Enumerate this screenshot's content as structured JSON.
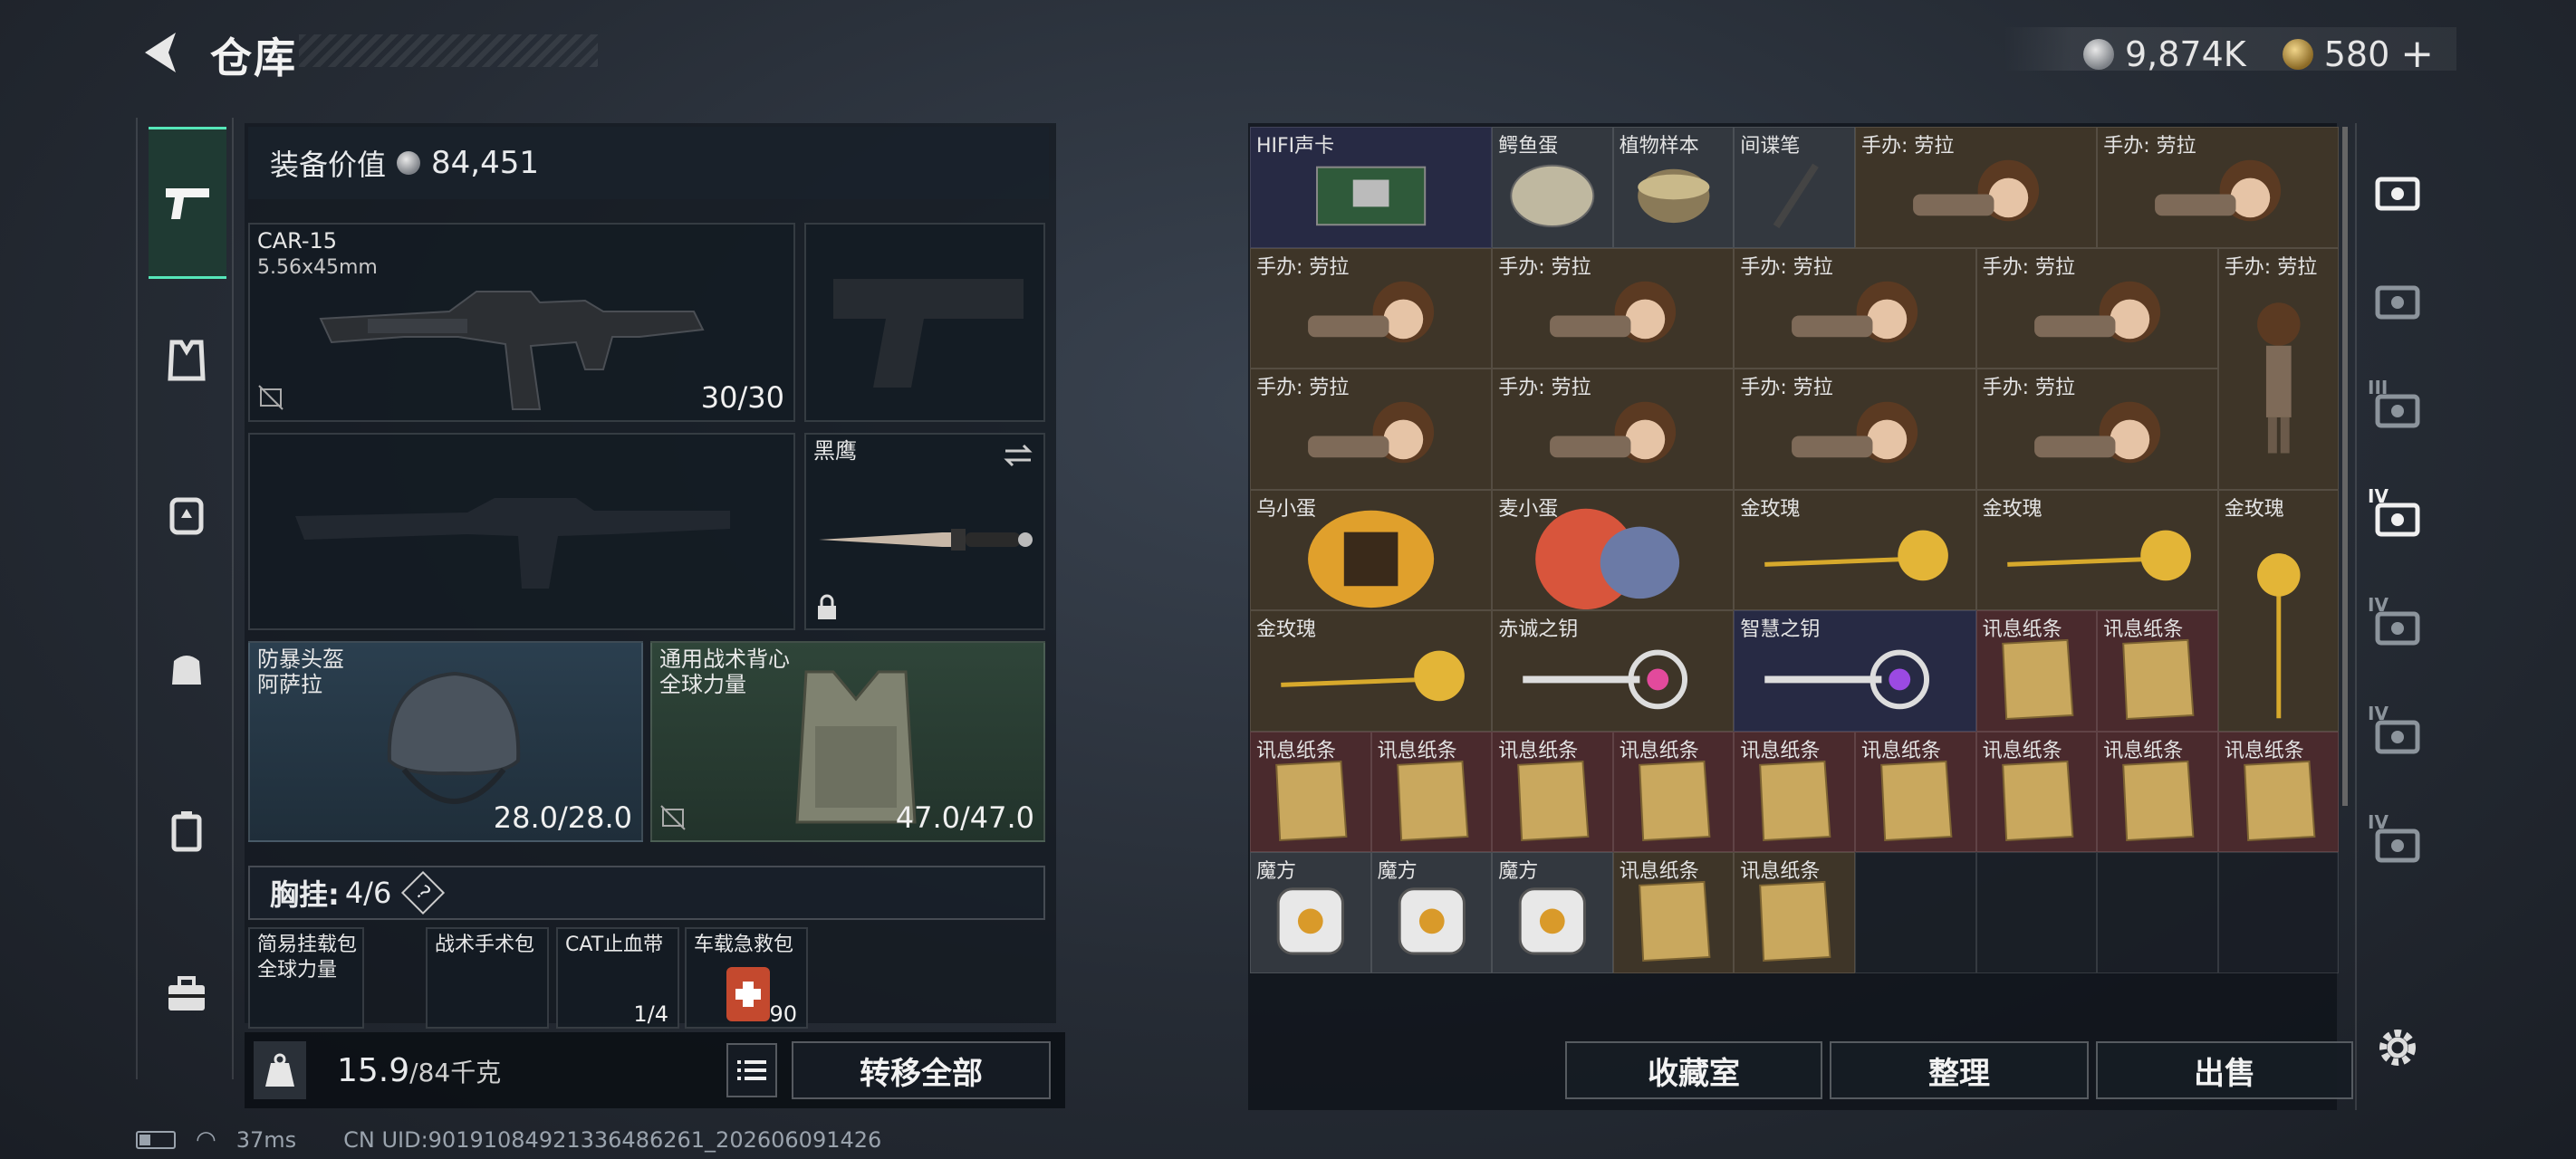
{
  "header": {
    "title": "仓库",
    "currency1": "9,874K",
    "currency2": "580",
    "plus": "+"
  },
  "equipment": {
    "value_label": "装备价值",
    "value": "84,451",
    "primary": {
      "name": "CAR-15",
      "ammo_type": "5.56x45mm",
      "ammo": "30/30"
    },
    "melee": {
      "name": "黑鹰"
    },
    "helmet": {
      "name": "防暴头盔",
      "sub": "阿萨拉",
      "durability": "28.0/28.0"
    },
    "vest": {
      "name": "通用战术背心",
      "sub": "全球力量",
      "durability": "47.0/47.0"
    },
    "rig": {
      "label": "胸挂:",
      "count": "4/6",
      "help": "?"
    },
    "rig_items": [
      {
        "name": "简易挂载包",
        "sub": "全球力量"
      },
      {
        "name": "战术手术包",
        "sub": ""
      },
      {
        "name": "CAT止血带",
        "sub": "",
        "val": "1/4"
      },
      {
        "name": "车载急救包",
        "sub": "",
        "val": "90"
      }
    ],
    "weight": "15.9",
    "weight_max": "/84千克",
    "transfer_all": "转移全部"
  },
  "stash": {
    "items": [
      {
        "label": "HIFI声卡",
        "q": "navy",
        "icon": "card"
      },
      {
        "label": "鳄鱼蛋",
        "q": "gray",
        "icon": "egg"
      },
      {
        "label": "植物样本",
        "q": "gray",
        "icon": "jar"
      },
      {
        "label": "间谍笔",
        "q": "gray",
        "icon": "pen"
      },
      {
        "label": "手办: 劳拉",
        "q": "brown",
        "icon": "figure"
      },
      {
        "label": "手办: 劳拉",
        "q": "brown",
        "icon": "figure"
      },
      {
        "label": "手办: 劳拉",
        "q": "brown",
        "icon": "figure"
      },
      {
        "label": "手办: 劳拉",
        "q": "brown",
        "icon": "figure"
      },
      {
        "label": "手办: 劳拉",
        "q": "brown",
        "icon": "figure"
      },
      {
        "label": "手办: 劳拉",
        "q": "brown",
        "icon": "figure"
      },
      {
        "label": "手办: 劳拉",
        "q": "brown",
        "icon": "figure-tall"
      },
      {
        "label": "手办: 劳拉",
        "q": "brown",
        "icon": "figure"
      },
      {
        "label": "手办: 劳拉",
        "q": "brown",
        "icon": "figure"
      },
      {
        "label": "手办: 劳拉",
        "q": "brown",
        "icon": "figure"
      },
      {
        "label": "手办: 劳拉",
        "q": "brown",
        "icon": "figure"
      },
      {
        "label": "乌小蛋",
        "q": "brown",
        "icon": "egg-big"
      },
      {
        "label": "麦小蛋",
        "q": "brown",
        "icon": "egg-big2"
      },
      {
        "label": "金玫瑰",
        "q": "brown",
        "icon": "rose"
      },
      {
        "label": "金玫瑰",
        "q": "brown",
        "icon": "rose"
      },
      {
        "label": "金玫瑰",
        "q": "brown",
        "icon": "rose-tall"
      },
      {
        "label": "金玫瑰",
        "q": "brown",
        "icon": "rose"
      },
      {
        "label": "赤诚之钥",
        "q": "brown",
        "icon": "key-pink"
      },
      {
        "label": "智慧之钥",
        "q": "navy",
        "icon": "key-purple"
      },
      {
        "label": "讯息纸条",
        "q": "red",
        "icon": "paper"
      },
      {
        "label": "讯息纸条",
        "q": "red",
        "icon": "paper"
      },
      {
        "label": "讯息纸条",
        "q": "red",
        "icon": "paper"
      },
      {
        "label": "讯息纸条",
        "q": "red",
        "icon": "paper"
      },
      {
        "label": "讯息纸条",
        "q": "red",
        "icon": "paper"
      },
      {
        "label": "讯息纸条",
        "q": "red",
        "icon": "paper"
      },
      {
        "label": "讯息纸条",
        "q": "red",
        "icon": "paper"
      },
      {
        "label": "讯息纸条",
        "q": "red",
        "icon": "paper"
      },
      {
        "label": "讯息纸条",
        "q": "red",
        "icon": "paper"
      },
      {
        "label": "讯息纸条",
        "q": "red",
        "icon": "paper"
      },
      {
        "label": "讯息纸条",
        "q": "red",
        "icon": "paper"
      },
      {
        "label": "魔方",
        "q": "gray",
        "icon": "cube"
      },
      {
        "label": "魔方",
        "q": "gray",
        "icon": "cube"
      },
      {
        "label": "魔方",
        "q": "gray",
        "icon": "cube"
      },
      {
        "label": "讯息纸条",
        "q": "brown",
        "icon": "paper"
      },
      {
        "label": "讯息纸条",
        "q": "brown",
        "icon": "paper"
      }
    ],
    "buttons": {
      "collection": "收藏室",
      "sort": "整理",
      "sell": "出售"
    }
  },
  "rightnav": [
    "",
    "",
    "III",
    "IV",
    "IV",
    "IV",
    "IV"
  ],
  "status": {
    "ping": "37ms",
    "uid": "CN UID:901910849213364862​61_202606091426"
  }
}
